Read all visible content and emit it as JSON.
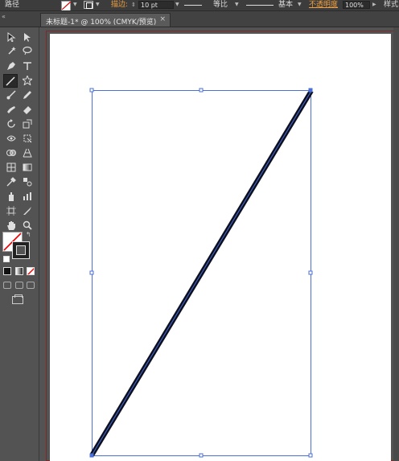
{
  "control_bar": {
    "tool_name": "路径",
    "stroke_label": "描边:",
    "stroke_weight": "10 pt",
    "profile_label": "等比",
    "brush_label": "基本",
    "opacity_label": "不透明度",
    "opacity_value": "100%",
    "style_label": "样式"
  },
  "tabs": {
    "collapse_glyph": "«",
    "doc_title": "未标题-1* @ 100% (CMYK/预览)",
    "close_glyph": "×"
  },
  "colors": {
    "accent_orange": "#f0a040",
    "selection_blue": "#4a6fd8",
    "path_stroke": "#0d1020",
    "artboard_border": "#7a2a2a"
  },
  "tools": [
    "selection-tool",
    "direct-selection-tool",
    "magic-wand-tool",
    "lasso-tool",
    "pen-tool",
    "type-tool",
    "line-segment-tool",
    "star-tool",
    "paintbrush-tool",
    "pencil-tool",
    "blob-brush-tool",
    "eraser-tool",
    "rotate-tool",
    "scale-tool",
    "width-tool",
    "free-transform-tool",
    "shape-builder-tool",
    "perspective-grid-tool",
    "mesh-tool",
    "gradient-tool",
    "eyedropper-tool",
    "blend-tool",
    "symbol-sprayer-tool",
    "column-graph-tool",
    "artboard-tool",
    "slice-tool",
    "hand-tool",
    "zoom-tool"
  ],
  "selected_tool": "line-segment-tool"
}
